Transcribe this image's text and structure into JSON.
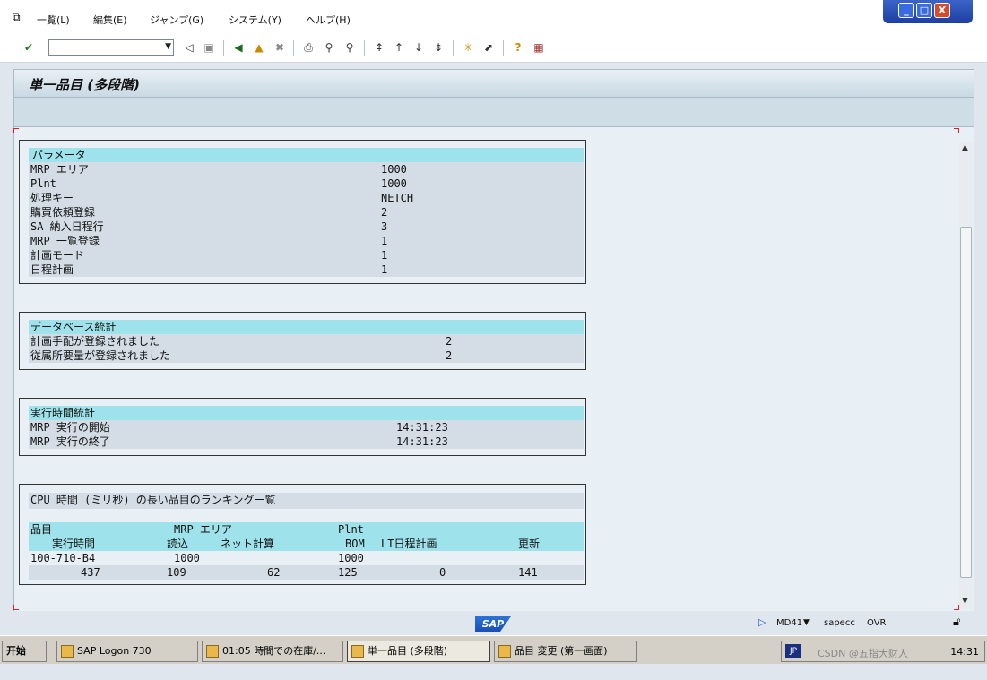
{
  "menu": {
    "items": [
      "一覧(L)",
      "編集(E)",
      "ジャンプ(G)",
      "システム(Y)",
      "ヘルプ(H)"
    ]
  },
  "window_controls": [
    "_",
    "□",
    "X"
  ],
  "toolbar": {
    "command_field_value": "",
    "icons": [
      "check-icon",
      "back-icon",
      "save-icon",
      "green-back-icon",
      "exit-icon",
      "cancel-icon",
      "print-icon",
      "find-icon",
      "find-next-icon",
      "first-page-icon",
      "prev-page-icon",
      "next-page-icon",
      "last-page-icon",
      "new-session-icon",
      "shortcut-icon",
      "help-icon",
      "layout-icon"
    ]
  },
  "title": "単一品目 (多段階)",
  "boxes": {
    "params": {
      "heading": "パラメータ",
      "rows": [
        {
          "label": "MRP エリア",
          "value": "1000"
        },
        {
          "label": "Plnt",
          "value": "1000"
        },
        {
          "label": "処理キー",
          "value": "NETCH"
        },
        {
          "label": "購買依頼登録",
          "value": "2"
        },
        {
          "label": "SA 納入日程行",
          "value": "3"
        },
        {
          "label": "MRP 一覧登録",
          "value": "1"
        },
        {
          "label": "計画モード",
          "value": "1"
        },
        {
          "label": "日程計画",
          "value": "1"
        }
      ]
    },
    "db_stats": {
      "heading": "データベース統計",
      "rows": [
        {
          "label": "計画手配が登録されました",
          "value": "2"
        },
        {
          "label": "従属所要量が登録されました",
          "value": "2"
        }
      ]
    },
    "runtime": {
      "heading": "実行時間統計",
      "rows": [
        {
          "label": "MRP 実行の開始",
          "value": "14:31:23"
        },
        {
          "label": "MRP 実行の終了",
          "value": "14:31:23"
        }
      ]
    },
    "cpu": {
      "heading": "CPU 時間 (ミリ秒) の長い品目のランキング一覧",
      "header1": [
        "品目",
        "MRP エリア",
        "Plnt"
      ],
      "header2": [
        "実行時間",
        "読込",
        "ネット計算",
        "BOM",
        "LT日程計画",
        "更新"
      ],
      "row1": [
        "100-710-B4",
        "1000",
        "1000"
      ],
      "row2": [
        "437",
        "109",
        "62",
        "125",
        "0",
        "141"
      ]
    }
  },
  "status": {
    "logo": "SAP",
    "transaction": "MD41",
    "server": "sapecc",
    "mode": "OVR"
  },
  "taskbar": {
    "start": "开始",
    "tasks": [
      "SAP Logon 730",
      "01:05 時間での在庫/...",
      "単一品目 (多段階)",
      "品目 変更 (第一画面)"
    ],
    "ime": "JP",
    "watermark": "CSDN @五指大财人",
    "clock": "14:31"
  }
}
